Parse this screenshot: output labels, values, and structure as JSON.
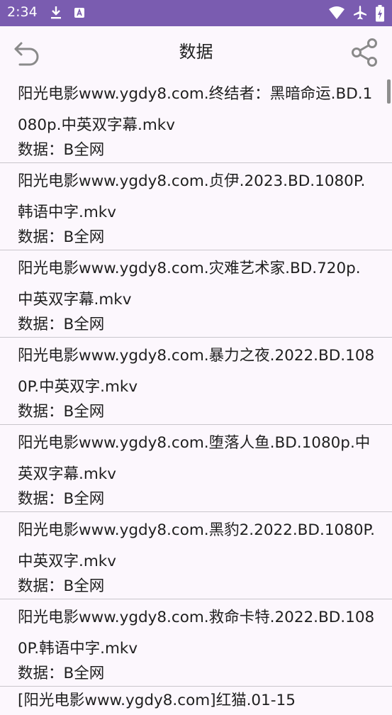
{
  "status_bar": {
    "time": "2:34",
    "icons": [
      "download-icon",
      "app-notification-icon",
      "wifi-icon",
      "airplane-mode-icon",
      "battery-charging-icon"
    ]
  },
  "app_bar": {
    "title": "数据",
    "back_icon": "back-icon",
    "share_icon": "share-icon"
  },
  "list": {
    "meta_label": "数据：",
    "items": [
      {
        "name": "阳光电影www.ygdy8.com.终结者：黑暗命运.BD.1080p.中英双字幕.mkv",
        "source": "B全网"
      },
      {
        "name": "阳光电影www.ygdy8.com.贞伊.2023.BD.1080P.韩语中字.mkv",
        "source": "B全网"
      },
      {
        "name": "阳光电影www.ygdy8.com.灾难艺术家.BD.720p.中英双字幕.mkv",
        "source": "B全网"
      },
      {
        "name": "阳光电影www.ygdy8.com.暴力之夜.2022.BD.1080P.中英双字.mkv",
        "source": "B全网"
      },
      {
        "name": "阳光电影www.ygdy8.com.堕落人鱼.BD.1080p.中英双字幕.mkv",
        "source": "B全网"
      },
      {
        "name": "阳光电影www.ygdy8.com.黑豹2.2022.BD.1080P.中英双字.mkv",
        "source": "B全网"
      },
      {
        "name": "阳光电影www.ygdy8.com.救命卡特.2022.BD.1080P.韩语中字.mkv",
        "source": "B全网"
      }
    ],
    "partial_item": "[阳光电影www.ygdy8.com]红猫.01-15"
  }
}
